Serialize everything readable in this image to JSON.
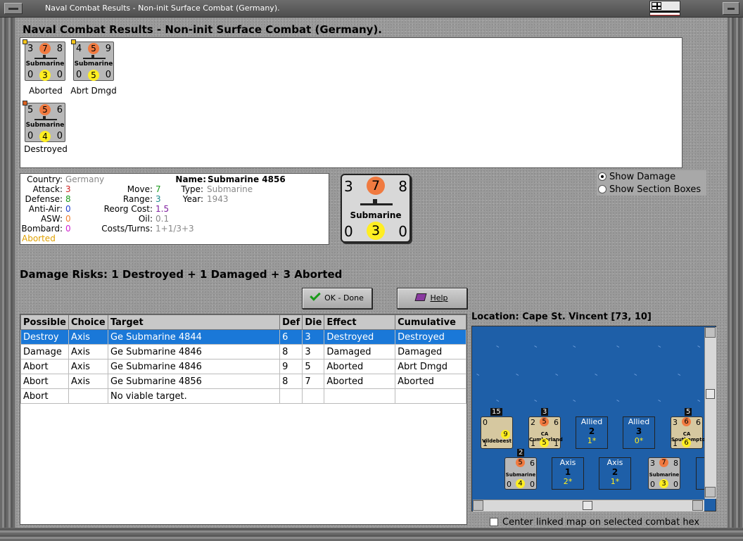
{
  "window": {
    "title": "Naval Combat Results - Non-init Surface Combat (Germany)."
  },
  "heading": "Naval Combat Results - Non-init Surface Combat (Germany).",
  "units": [
    {
      "tl": "3",
      "tc": "7",
      "tr": "8",
      "name": "Submarine",
      "bl": "0",
      "bc": "3",
      "br": "0",
      "status": "Aborted"
    },
    {
      "tl": "4",
      "tc": "5",
      "tr": "9",
      "name": "Submarine",
      "bl": "0",
      "bc": "5",
      "br": "0",
      "status": "Abrt Dmgd"
    },
    {
      "tl": "5",
      "tc": "5",
      "tr": "6",
      "name": "Submarine",
      "bl": "0",
      "bc": "4",
      "br": "0",
      "status": "Destroyed"
    }
  ],
  "info": {
    "country_label": "Country:",
    "country": "Germany",
    "attack_label": "Attack:",
    "attack": "3",
    "defense_label": "Defense:",
    "defense": "8",
    "antiair_label": "Anti-Air:",
    "antiair": "0",
    "asw_label": "ASW:",
    "asw": "0",
    "bombard_label": "Bombard:",
    "bombard": "0",
    "status": "Aborted",
    "move_label": "Move:",
    "move": "7",
    "range_label": "Range:",
    "range": "3",
    "reorg_label": "Reorg Cost:",
    "reorg": "1.5",
    "oil_label": "Oil:",
    "oil": "0.1",
    "costs_label": "Costs/Turns:",
    "costs": "1+1/3+3",
    "name_label": "Name:",
    "name": "Submarine 4856",
    "type_label": "Type:",
    "type": "Submarine",
    "year_label": "Year:",
    "year": "1943"
  },
  "big_counter": {
    "tl": "3",
    "tc": "7",
    "tr": "8",
    "name": "Submarine",
    "bl": "0",
    "bc": "3",
    "br": "0"
  },
  "options": {
    "show_damage": "Show Damage",
    "show_sections": "Show Section Boxes"
  },
  "damage_risks": "Damage Risks:  1 Destroyed + 1 Damaged + 3 Aborted",
  "buttons": {
    "ok": "OK - Done",
    "help": "Help"
  },
  "table": {
    "headers": [
      "Possible",
      "Choice",
      "Target",
      "Def",
      "Die",
      "Effect",
      "Cumulative"
    ],
    "rows": [
      [
        "Destroy",
        "Axis",
        "Ge Submarine 4844",
        "6",
        "3",
        "Destroyed",
        "Destroyed"
      ],
      [
        "Damage",
        "Axis",
        "Ge Submarine 4846",
        "8",
        "3",
        "Damaged",
        "Damaged"
      ],
      [
        "Abort",
        "Axis",
        "Ge Submarine 4846",
        "9",
        "5",
        "Aborted",
        "Abrt Dmgd"
      ],
      [
        "Abort",
        "Axis",
        "Ge Submarine 4856",
        "8",
        "7",
        "Aborted",
        "Aborted"
      ],
      [
        "Abort",
        "",
        "No viable target.",
        "",
        "",
        "",
        ""
      ]
    ]
  },
  "location": "Location:  Cape St. Vincent [73, 10]",
  "map": {
    "stacks": [
      {
        "badge": "15",
        "tl": "0",
        "name": "Vildebeest",
        "bl": "1",
        "bc": "9"
      },
      {
        "badge": "3",
        "tl": "2",
        "tc": "5",
        "tr": "6",
        "name": "CA Cumberland",
        "bl": "1",
        "bc": "5",
        "br": "1"
      },
      {
        "badge": "5",
        "tl": "3",
        "tc": "6",
        "tr": "6",
        "name": "CA Southampton",
        "bl": "1",
        "bc": "6",
        "br": ""
      },
      {
        "badge": "2",
        "tl": "",
        "tc": "5",
        "tr": "6",
        "name": "Submarine",
        "bl": "0",
        "bc": "4",
        "br": "0"
      },
      {
        "badge": "",
        "tl": "3",
        "tc": "7",
        "tr": "8",
        "name": "Submarine",
        "bl": "0",
        "bc": "3",
        "br": "0"
      }
    ],
    "boxes": [
      {
        "side": "Allied",
        "num": "2",
        "sub": "1*"
      },
      {
        "side": "Allied",
        "num": "3",
        "sub": "0*"
      },
      {
        "side": "Axis",
        "num": "1",
        "sub": "2*"
      },
      {
        "side": "Axis",
        "num": "2",
        "sub": "1*"
      }
    ],
    "partial_box_label": "A"
  },
  "center_map_label": "Center linked map on selected combat hex"
}
